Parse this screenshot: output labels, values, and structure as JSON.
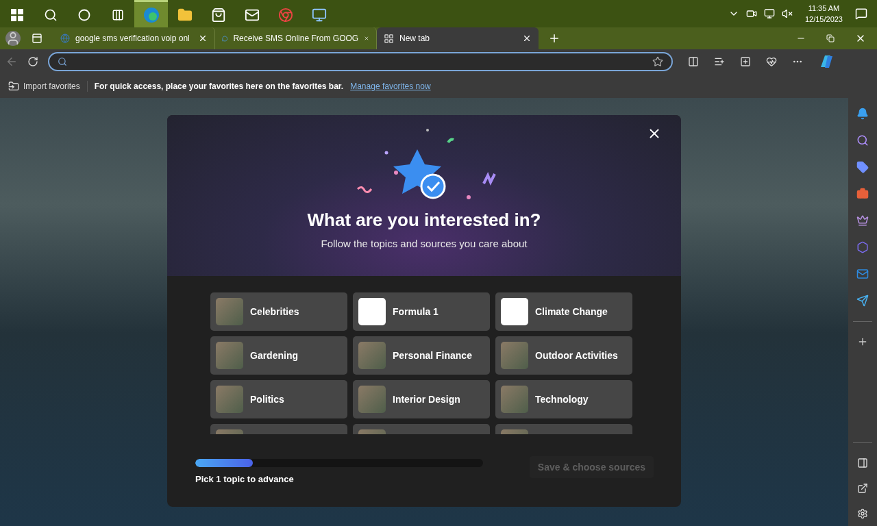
{
  "taskbar": {
    "apps": [
      {
        "kind": "search",
        "selected": false
      },
      {
        "kind": "cortana",
        "selected": false
      },
      {
        "kind": "taskview",
        "selected": false
      },
      {
        "kind": "edge",
        "selected": true
      },
      {
        "kind": "folder",
        "selected": false
      },
      {
        "kind": "store",
        "selected": false
      },
      {
        "kind": "mail",
        "selected": false
      },
      {
        "kind": "chrome",
        "selected": false
      },
      {
        "kind": "remote",
        "selected": false
      }
    ],
    "time": "11:35 AM",
    "date": "12/15/2023"
  },
  "tabs": [
    {
      "title": "google sms verification voip onl",
      "kind": "web",
      "selected": false
    },
    {
      "title": "Receive SMS Online From GOOG",
      "kind": "chat",
      "selected": false
    },
    {
      "title": "New tab",
      "kind": "newtab",
      "selected": true
    }
  ],
  "favorites_bar": {
    "import": "Import favorites",
    "message": "For quick access, place your favorites here on the favorites bar.",
    "link": "Manage favorites now"
  },
  "dialog": {
    "title": "What are you interested in?",
    "subtitle": "Follow the topics and sources you care about",
    "topics": [
      {
        "label": "Celebrities",
        "kind": "photo"
      },
      {
        "label": "Formula 1",
        "kind": "logo"
      },
      {
        "label": "Climate Change",
        "kind": "logo"
      },
      {
        "label": "Gardening",
        "kind": "photo"
      },
      {
        "label": "Personal Finance",
        "kind": "photo"
      },
      {
        "label": "Outdoor Activities",
        "kind": "photo"
      },
      {
        "label": "Politics",
        "kind": "photo"
      },
      {
        "label": "Interior Design",
        "kind": "photo"
      },
      {
        "label": "Technology",
        "kind": "photo"
      },
      {
        "kind": "photo"
      },
      {
        "kind": "photo"
      },
      {
        "kind": "photo"
      }
    ],
    "progress": {
      "level": 0.2,
      "label": "Pick 1 topic to advance"
    },
    "button": {
      "label": "Save & choose sources",
      "disabled": true
    }
  }
}
